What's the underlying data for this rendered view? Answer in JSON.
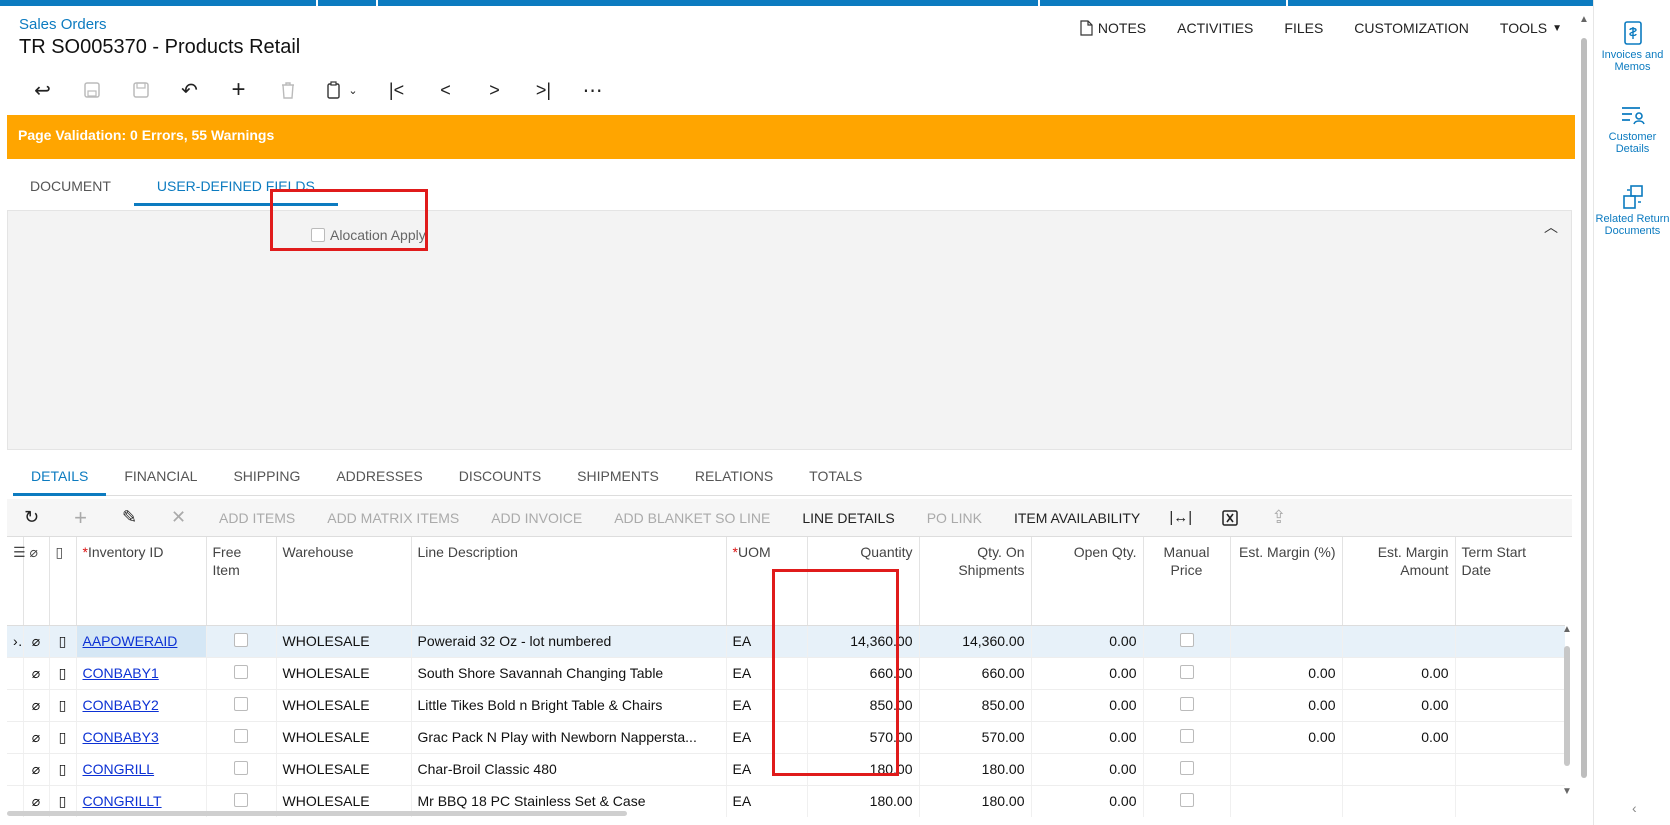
{
  "header": {
    "breadcrumb": "Sales Orders",
    "title": "TR SO005370 - Products Retail",
    "actions": {
      "notes": "NOTES",
      "activities": "ACTIVITIES",
      "files": "FILES",
      "customization": "CUSTOMIZATION",
      "tools": "TOOLS"
    }
  },
  "toolbar_icons": [
    "undo-back-icon",
    "save-close-icon",
    "save-icon",
    "cancel-icon",
    "add-icon",
    "delete-icon",
    "copy-paste-icon",
    "first-record-icon",
    "previous-record-icon",
    "next-record-icon",
    "last-record-icon",
    "more-icon"
  ],
  "validation": {
    "text": "Page Validation: 0 Errors, 55 Warnings",
    "color": "#ffa500"
  },
  "main_tabs": {
    "document": "DOCUMENT",
    "user_defined_fields": "USER-DEFINED FIELDS",
    "active": "USER-DEFINED FIELDS"
  },
  "udf": {
    "alocation_apply_label": "Alocation Apply",
    "alocation_apply_checked": false
  },
  "detail_tabs": [
    "DETAILS",
    "FINANCIAL",
    "SHIPPING",
    "ADDRESSES",
    "DISCOUNTS",
    "SHIPMENTS",
    "RELATIONS",
    "TOTALS"
  ],
  "grid_toolbar": {
    "add_items": "ADD ITEMS",
    "add_matrix_items": "ADD MATRIX ITEMS",
    "add_invoice": "ADD INVOICE",
    "add_blanket_so_line": "ADD BLANKET SO LINE",
    "line_details": "LINE DETAILS",
    "po_link": "PO LINK",
    "item_availability": "ITEM AVAILABILITY"
  },
  "grid": {
    "columns": {
      "inventory_id": "Inventory ID",
      "free_item": "Free Item",
      "warehouse": "Warehouse",
      "line_description": "Line Description",
      "uom": "UOM",
      "quantity": "Quantity",
      "qty_on_shipments": "Qty. On Shipments",
      "open_qty": "Open Qty.",
      "manual_price": "Manual Price",
      "est_margin_pct": "Est. Margin (%)",
      "est_margin_amount": "Est. Margin Amount",
      "term_start_date": "Term Start Date"
    },
    "rows": [
      {
        "inventory_id": "AAPOWERAID",
        "warehouse": "WHOLESALE",
        "description": "Poweraid 32 Oz - lot numbered",
        "uom": "EA",
        "quantity": "14,360.00",
        "qty_on_shipments": "14,360.00",
        "open_qty": "0.00",
        "est_margin_pct": "",
        "est_margin_amount": ""
      },
      {
        "inventory_id": "CONBABY1",
        "warehouse": "WHOLESALE",
        "description": "South Shore Savannah Changing Table",
        "uom": "EA",
        "quantity": "660.00",
        "qty_on_shipments": "660.00",
        "open_qty": "0.00",
        "est_margin_pct": "0.00",
        "est_margin_amount": "0.00"
      },
      {
        "inventory_id": "CONBABY2",
        "warehouse": "WHOLESALE",
        "description": "Little Tikes Bold n Bright Table & Chairs",
        "uom": "EA",
        "quantity": "850.00",
        "qty_on_shipments": "850.00",
        "open_qty": "0.00",
        "est_margin_pct": "0.00",
        "est_margin_amount": "0.00"
      },
      {
        "inventory_id": "CONBABY3",
        "warehouse": "WHOLESALE",
        "description": "Grac Pack N Play with Newborn Nappersta...",
        "uom": "EA",
        "quantity": "570.00",
        "qty_on_shipments": "570.00",
        "open_qty": "0.00",
        "est_margin_pct": "0.00",
        "est_margin_amount": "0.00"
      },
      {
        "inventory_id": "CONGRILL",
        "warehouse": "WHOLESALE",
        "description": "Char-Broil Classic 480",
        "uom": "EA",
        "quantity": "180.00",
        "qty_on_shipments": "180.00",
        "open_qty": "0.00",
        "est_margin_pct": "",
        "est_margin_amount": ""
      },
      {
        "inventory_id": "CONGRILLT",
        "warehouse": "WHOLESALE",
        "description": "Mr BBQ 18 PC Stainless Set & Case",
        "uom": "EA",
        "quantity": "180.00",
        "qty_on_shipments": "180.00",
        "open_qty": "0.00",
        "est_margin_pct": "",
        "est_margin_amount": ""
      }
    ]
  },
  "right_panel": {
    "invoices_and_memos": "Invoices and Memos",
    "customer_details": "Customer Details",
    "related_return_documents": "Related Return Documents"
  },
  "colors": {
    "accent": "#0c7bc0",
    "warning": "#ffa500",
    "highlight": "#e01b1b"
  }
}
